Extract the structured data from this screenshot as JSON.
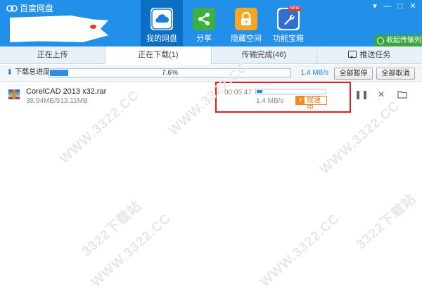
{
  "app": {
    "title": "百度网盘"
  },
  "nav": [
    {
      "label": "我的网盘",
      "icon": "cloud-icon",
      "active": true
    },
    {
      "label": "分享",
      "icon": "share-icon",
      "active": false
    },
    {
      "label": "隐藏空间",
      "icon": "lock-icon",
      "active": false
    },
    {
      "label": "功能宝箱",
      "icon": "wrench-icon",
      "active": false,
      "badge": "NEW"
    }
  ],
  "window_controls": {
    "menu": "▾",
    "minimize": "—",
    "maximize": "□",
    "close": "✕"
  },
  "collapse_button": "收起传输列表",
  "tabs": [
    {
      "label": "正在上传",
      "active": false
    },
    {
      "label": "正在下载(1)",
      "active": true
    },
    {
      "label": "传输完成(46)",
      "active": false
    },
    {
      "label": "推送任务",
      "active": false,
      "icon": "push-task-icon"
    }
  ],
  "total": {
    "label": "下载总进度",
    "percent": "7.6%",
    "progress": 0.076,
    "speed": "1.4 MB/s",
    "pause_all": "全部暂停",
    "cancel_all": "全部取消"
  },
  "download": {
    "file_name": "CorelCAD 2013 x32.rar",
    "size": "38.94MB/513.11MB",
    "time_left": "00:05:47",
    "progress": 0.076,
    "speed": "1.4 MB/s",
    "boost": "提速中",
    "icon": "rar-archive-icon"
  },
  "row_actions": {
    "pause": "pause-icon",
    "cancel": "close-icon",
    "folder": "folder-icon"
  },
  "watermark": "WWW.3322.CC",
  "watermark_cn": "3322下载站",
  "colors": {
    "header": "#2290e9",
    "accent": "#2f8ce0",
    "highlight": "#e51c1c",
    "boost": "#f08c1f",
    "collapse": "#3aa83f"
  }
}
